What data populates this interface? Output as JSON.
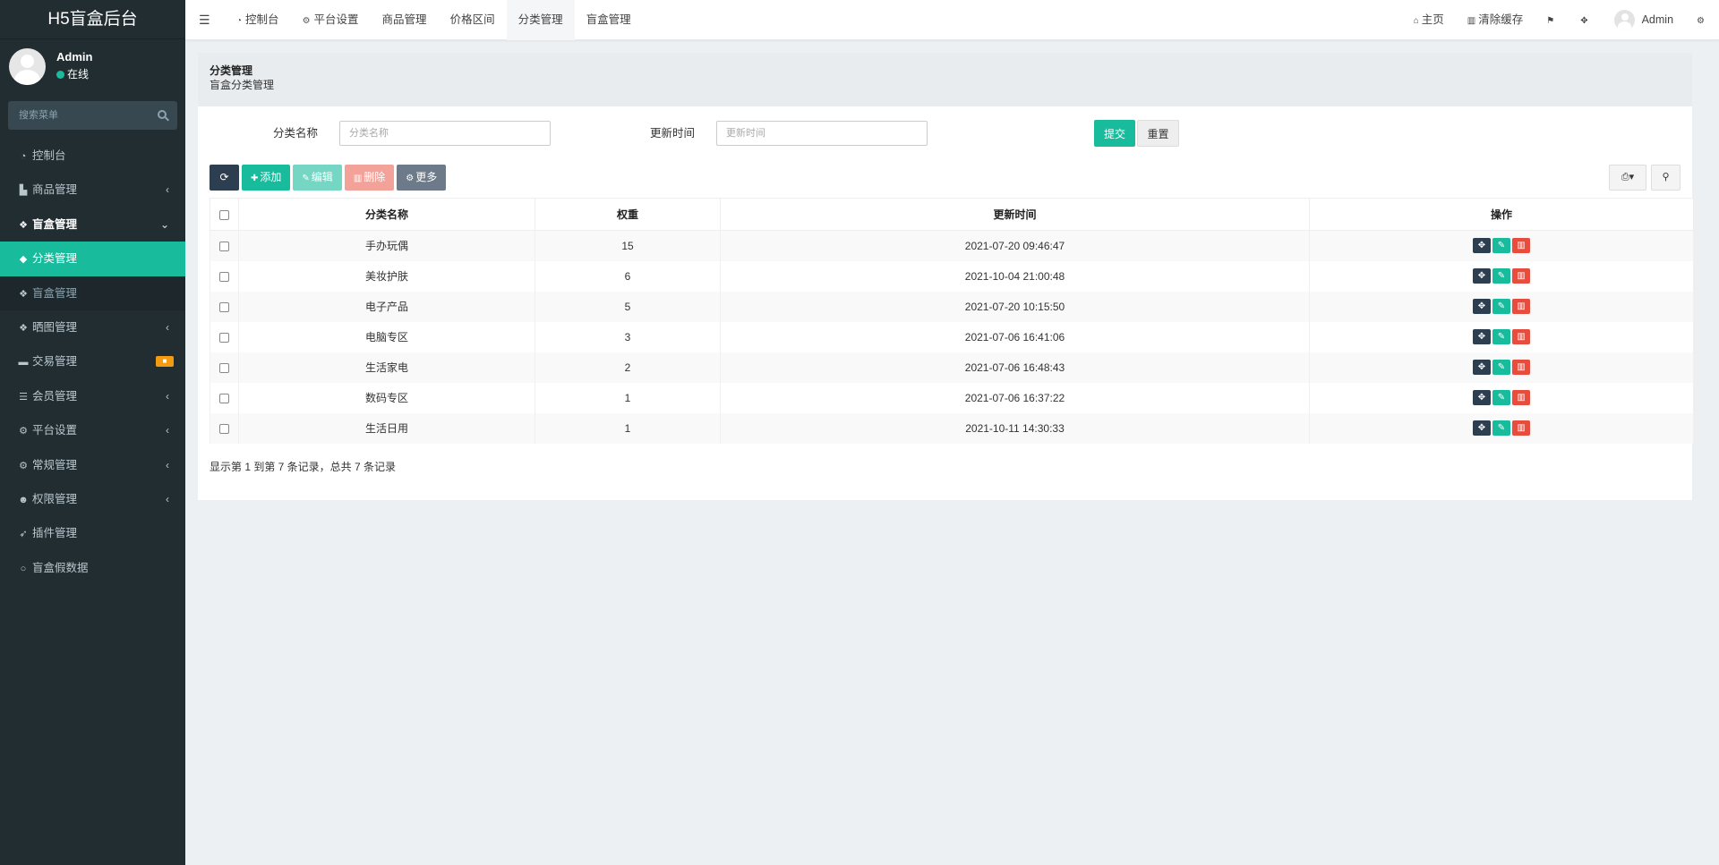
{
  "app": {
    "title": "H5盲盒后台"
  },
  "user": {
    "name": "Admin",
    "status": "在线"
  },
  "sidebar": {
    "search_placeholder": "搜索菜单",
    "items": [
      {
        "label": "控制台",
        "icon": "dashboard-icon"
      },
      {
        "label": "商品管理",
        "icon": "shopping-bag-icon",
        "caret": "‹"
      },
      {
        "label": "盲盒管理",
        "icon": "dropbox-icon",
        "caret": "⌄"
      },
      {
        "label": "分类管理",
        "icon": "tags-icon"
      },
      {
        "label": "盲盒管理",
        "icon": "dropbox-icon"
      },
      {
        "label": "晒图管理",
        "icon": "dropbox-icon",
        "caret": "‹"
      },
      {
        "label": "交易管理",
        "icon": "cart-icon",
        "badge": "■"
      },
      {
        "label": "会员管理",
        "icon": "list-icon",
        "caret": "‹"
      },
      {
        "label": "平台设置",
        "icon": "cogs-icon",
        "caret": "‹"
      },
      {
        "label": "常规管理",
        "icon": "cogs-icon",
        "caret": "‹"
      },
      {
        "label": "权限管理",
        "icon": "group-icon",
        "caret": "‹"
      },
      {
        "label": "插件管理",
        "icon": "rocket-icon"
      },
      {
        "label": "盲盒假数据",
        "icon": "circle-icon"
      }
    ]
  },
  "topbar": {
    "tabs": [
      {
        "label": "控制台",
        "icon": "dashboard-icon"
      },
      {
        "label": "平台设置",
        "icon": "cog-icon"
      },
      {
        "label": "商品管理"
      },
      {
        "label": "价格区间"
      },
      {
        "label": "分类管理"
      },
      {
        "label": "盲盒管理"
      }
    ],
    "right": {
      "home": "主页",
      "clear_cache": "清除缓存",
      "admin": "Admin"
    }
  },
  "panel": {
    "title": "分类管理",
    "subtitle": "盲盒分类管理",
    "filters": {
      "name_label": "分类名称",
      "name_placeholder": "分类名称",
      "time_label": "更新时间",
      "time_placeholder": "更新时间",
      "submit": "提交",
      "reset": "重置"
    },
    "toolbar": {
      "add": "添加",
      "edit": "编辑",
      "delete": "删除",
      "more": "更多"
    },
    "table": {
      "columns": [
        "分类名称",
        "权重",
        "更新时间",
        "操作"
      ],
      "rows": [
        {
          "name": "手办玩偶",
          "weight": "15",
          "time": "2021-07-20 09:46:47"
        },
        {
          "name": "美妆护肤",
          "weight": "6",
          "time": "2021-10-04 21:00:48"
        },
        {
          "name": "电子产品",
          "weight": "5",
          "time": "2021-07-20 10:15:50"
        },
        {
          "name": "电脑专区",
          "weight": "3",
          "time": "2021-07-06 16:41:06"
        },
        {
          "name": "生活家电",
          "weight": "2",
          "time": "2021-07-06 16:48:43"
        },
        {
          "name": "数码专区",
          "weight": "1",
          "time": "2021-07-06 16:37:22"
        },
        {
          "name": "生活日用",
          "weight": "1",
          "time": "2021-10-11 14:30:33"
        }
      ]
    },
    "pager_info": "显示第 1 到第 7 条记录，总共 7 条记录"
  },
  "colors": {
    "accent": "#18bc9c",
    "sidebar_bg": "#222d32",
    "danger": "#e74c3c",
    "dark": "#2c3e50"
  }
}
